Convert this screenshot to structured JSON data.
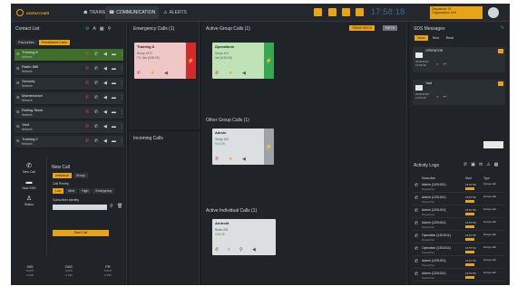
{
  "header": {
    "logo": "DISPATCHER",
    "tabs": [
      {
        "label": "TRAINEE",
        "icon": "people-icon"
      },
      {
        "label": "COMMUNICATION",
        "icon": "phone-icon"
      },
      {
        "label": "ALERTS",
        "icon": "warning-icon"
      }
    ],
    "clock": "17:58:18",
    "user_line1": "Dispatcher 01",
    "user_line2": "Organisation Unit",
    "accent_color": "#e8a317"
  },
  "contacts": {
    "title": "Contact List",
    "tabs": [
      "Favourites",
      "Predefined Calls"
    ],
    "rows": [
      {
        "name": "Training 8",
        "status": "Network"
      },
      {
        "name": "Radio 888",
        "status": "Network"
      },
      {
        "name": "Security",
        "status": "Network"
      },
      {
        "name": "Maintenance",
        "status": "Network"
      },
      {
        "name": "Rolling Stock",
        "status": "Network"
      },
      {
        "name": "Yard",
        "status": "Network"
      },
      {
        "name": "Training 2",
        "status": "Network"
      }
    ]
  },
  "sidebar": {
    "items": [
      {
        "label": "New Call",
        "icon": "phone-icon"
      },
      {
        "label": "New SDS",
        "icon": "message-icon"
      },
      {
        "label": "Status",
        "icon": "status-icon"
      }
    ]
  },
  "new_call": {
    "title": "New Call",
    "call_types": [
      "Individual",
      "Group"
    ],
    "priority_label": "Call Priority",
    "priorities": [
      "Low",
      "Med",
      "High",
      "Emergency"
    ],
    "identity_label": "Subscriber Identity",
    "input_placeholder": "",
    "start_button": "Start Call"
  },
  "stats": [
    {
      "label": "005",
      "sub1": "0 AVC",
      "sub2": "0 IND"
    },
    {
      "label": "DAS",
      "sub1": "0 AVC",
      "sub2": "0 IND"
    },
    {
      "label": "PR",
      "sub1": "0 AVC",
      "sub2": "0 IND"
    }
  ],
  "emergency": {
    "title": "Emergency Calls (1)",
    "card": {
      "name": "Training 8",
      "sub": "Group 1071",
      "detail": "TX: 0ch (0:00:09)"
    }
  },
  "incoming": {
    "title": "Incoming Calls"
  },
  "active": {
    "title": "Active Group Calls (1)",
    "buttons": [
      "TRANS PATCH",
      "PATCH"
    ],
    "group_card": {
      "name": "Operations",
      "sub": "Group 101",
      "detail": "0ch (0:00:09)"
    },
    "other_title": "Other Group Calls (1)",
    "other_card": {
      "name": "Admin",
      "sub": "Group 102",
      "detail": "0:01:09"
    },
    "individual_title": "Active Individual Calls (1)",
    "individual_card": {
      "name": "Android",
      "sub": "Radio 001",
      "detail": "0:00:09"
    }
  },
  "sds": {
    "title": "SDS Messages",
    "tabs": [
      "Inbox",
      "Sent",
      "Read"
    ],
    "messages": [
      {
        "from": "OPERATOR",
        "date1": "2016/11/04",
        "time": "13:59:32"
      },
      {
        "from": "Yard",
        "date1": "2016/11/04",
        "time": "13:59:10"
      }
    ]
  },
  "activity": {
    "title": "Activity Logs",
    "columns": [
      "Subscriber",
      "Start",
      "Type"
    ],
    "rows": [
      {
        "name": "Admin (1201011)",
        "sub": "Dispatcher",
        "time": "13:57:50",
        "type": "Group call"
      },
      {
        "name": "Admin (1201011)",
        "sub": "Dispatcher",
        "time": "13:57:50",
        "type": "Group call"
      },
      {
        "name": "Admin (1201011)",
        "sub": "Dispatcher",
        "time": "13:57:50",
        "type": "Group call"
      },
      {
        "name": "Admin (1201011)",
        "sub": "Dispatcher",
        "time": "13:57:50",
        "type": "Group call"
      },
      {
        "name": "Operation (1201011)",
        "sub": "Dispatcher",
        "time": "13:57:50",
        "type": "Group call"
      },
      {
        "name": "Operation (1201011)",
        "sub": "Dispatcher",
        "time": "13:57:50",
        "type": "Group call"
      },
      {
        "name": "Admin (1201011)",
        "sub": "Dispatcher",
        "time": "13:57:50",
        "type": "Group call"
      },
      {
        "name": "Admin (1201011)",
        "sub": "Dispatcher",
        "time": "13:57:50",
        "type": "Group call"
      }
    ]
  }
}
